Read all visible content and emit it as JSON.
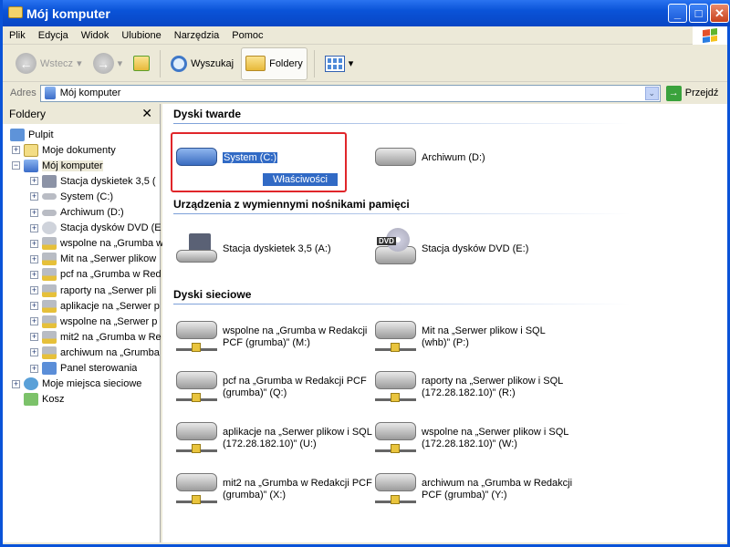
{
  "window": {
    "title": "Mój komputer"
  },
  "menu": [
    "Plik",
    "Edycja",
    "Widok",
    "Ulubione",
    "Narzędzia",
    "Pomoc"
  ],
  "toolbar": {
    "back": "Wstecz",
    "search": "Wyszukaj",
    "folders": "Foldery"
  },
  "address": {
    "label": "Adres",
    "value": "Mój komputer",
    "go": "Przejdź"
  },
  "folders_pane": {
    "title": "Foldery",
    "tree": [
      {
        "label": "Pulpit",
        "icon": "desktop-icon",
        "level": 0,
        "expander": ""
      },
      {
        "label": "Moje dokumenty",
        "icon": "my-documents-icon",
        "level": 1,
        "expander": "+"
      },
      {
        "label": "Mój komputer",
        "icon": "my-computer-icon",
        "level": 1,
        "expander": "-",
        "selected": true
      },
      {
        "label": "Stacja dyskietek 3,5 (",
        "icon": "floppy-drive-icon",
        "level": 2,
        "expander": "+"
      },
      {
        "label": "System (C:)",
        "icon": "hard-drive-icon",
        "level": 2,
        "expander": "+"
      },
      {
        "label": "Archiwum (D:)",
        "icon": "hard-drive-icon",
        "level": 2,
        "expander": "+"
      },
      {
        "label": "Stacja dysków DVD (E",
        "icon": "dvd-drive-icon",
        "level": 2,
        "expander": "+"
      },
      {
        "label": "wspolne na „Grumba w",
        "icon": "network-drive-icon",
        "level": 2,
        "expander": "+"
      },
      {
        "label": "Mit na „Serwer plikow",
        "icon": "network-drive-icon",
        "level": 2,
        "expander": "+"
      },
      {
        "label": "pcf na „Grumba w Red",
        "icon": "network-drive-icon",
        "level": 2,
        "expander": "+"
      },
      {
        "label": "raporty na „Serwer pli",
        "icon": "network-drive-icon",
        "level": 2,
        "expander": "+"
      },
      {
        "label": "aplikacje na „Serwer p",
        "icon": "network-drive-icon",
        "level": 2,
        "expander": "+"
      },
      {
        "label": "wspolne na „Serwer p",
        "icon": "network-drive-icon",
        "level": 2,
        "expander": "+"
      },
      {
        "label": "mit2 na „Grumba w Re",
        "icon": "network-drive-icon",
        "level": 2,
        "expander": "+"
      },
      {
        "label": "archiwum na „Grumba",
        "icon": "network-drive-icon",
        "level": 2,
        "expander": "+"
      },
      {
        "label": "Panel sterowania",
        "icon": "control-panel-icon",
        "level": 2,
        "expander": "+"
      },
      {
        "label": "Moje miejsca sieciowe",
        "icon": "network-places-icon",
        "level": 1,
        "expander": "+"
      },
      {
        "label": "Kosz",
        "icon": "recycle-bin-icon",
        "level": 1,
        "expander": ""
      }
    ]
  },
  "content": {
    "sections": [
      {
        "title": "Dyski twarde",
        "items": [
          {
            "label": "System (C:)",
            "type": "hdd",
            "selected": true,
            "tooltip": "Właściwości"
          },
          {
            "label": "Archiwum (D:)",
            "type": "hdd"
          }
        ]
      },
      {
        "title": "Urządzenia z wymiennymi nośnikami pamięci",
        "items": [
          {
            "label": "Stacja dyskietek 3,5 (A:)",
            "type": "floppy"
          },
          {
            "label": "Stacja dysków DVD (E:)",
            "type": "dvd"
          }
        ]
      },
      {
        "title": "Dyski sieciowe",
        "items": [
          {
            "label": "wspolne na „Grumba w Redakcji PCF (grumba)” (M:)",
            "type": "net"
          },
          {
            "label": "Mit na „Serwer plikow i SQL (whb)” (P:)",
            "type": "net"
          },
          {
            "label": "pcf na „Grumba w Redakcji PCF (grumba)” (Q:)",
            "type": "net"
          },
          {
            "label": "raporty na „Serwer plikow i SQL (172.28.182.10)” (R:)",
            "type": "net"
          },
          {
            "label": "aplikacje na „Serwer plikow i SQL (172.28.182.10)” (U:)",
            "type": "net"
          },
          {
            "label": "wspolne na „Serwer plikow i SQL (172.28.182.10)” (W:)",
            "type": "net"
          },
          {
            "label": "mit2 na „Grumba w Redakcji PCF (grumba)” (X:)",
            "type": "net"
          },
          {
            "label": "archiwum na „Grumba w Redakcji PCF (grumba)” (Y:)",
            "type": "net"
          }
        ]
      }
    ]
  },
  "colors": {
    "titlebar": "#0a53d8",
    "selection": "#316ac5",
    "highlight_box": "#e0262a"
  }
}
